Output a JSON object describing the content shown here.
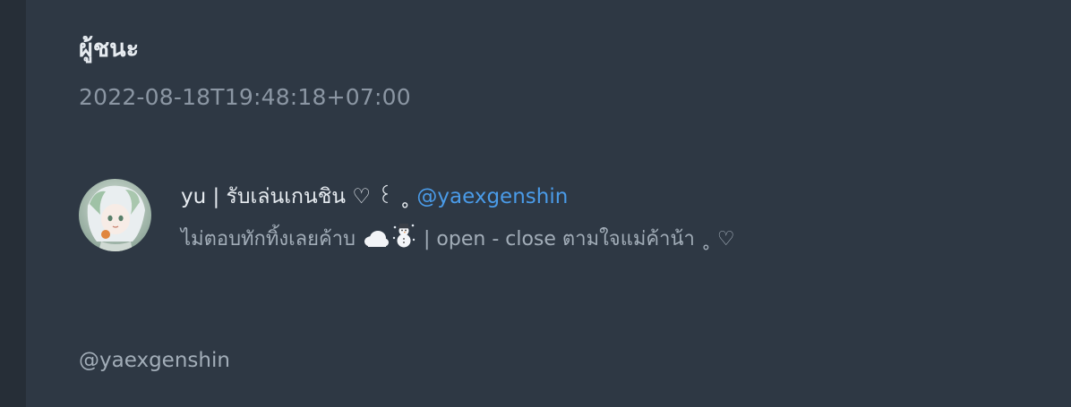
{
  "post": {
    "title": "ผู้ชนะ",
    "timestamp": "2022-08-18T19:48:18+07:00"
  },
  "profile": {
    "display_name": "yu | รับเล่นเกนชิน ♡ ꒰ ˳",
    "handle": "@yaexgenshin",
    "bio_prefix": "ไม่ตอบทักทิ้งเลยค้าบ",
    "bio_suffix": "| open - close ตามใจแม่ค้าน้า ˳ ♡",
    "bio_icons": [
      "cloud-icon",
      "snowman-icon"
    ],
    "avatar_icon": "avatar-anime-girl"
  },
  "footer": {
    "handle": "@yaexgenshin"
  },
  "colors": {
    "background": "#2e3844",
    "rail": "#262e37",
    "link": "#4a9be8",
    "muted": "#8b96a3"
  }
}
